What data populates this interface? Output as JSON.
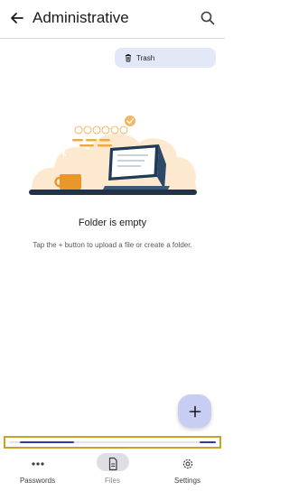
{
  "header": {
    "title": "Administrative",
    "back_icon": "arrow-back-icon",
    "search_icon": "search-icon"
  },
  "trash_chip": {
    "label": "Trash",
    "icon": "trash-icon"
  },
  "empty_state": {
    "title": "Folder is empty",
    "subtitle": "Tap the + button to upload a file or create a folder."
  },
  "fab": {
    "icon": "plus-icon"
  },
  "nav": {
    "items": [
      {
        "label": "Passwords",
        "icon": "dots-icon",
        "active": false
      },
      {
        "label": "Files",
        "icon": "file-icon",
        "active": true
      },
      {
        "label": "Settings",
        "icon": "gear-icon",
        "active": false
      }
    ]
  },
  "colors": {
    "accent": "#c8cdf3",
    "chip_bg": "#e3e8f9",
    "scroll_highlight": "#c9a227",
    "scroll_thumb": "#2f3aa4"
  }
}
